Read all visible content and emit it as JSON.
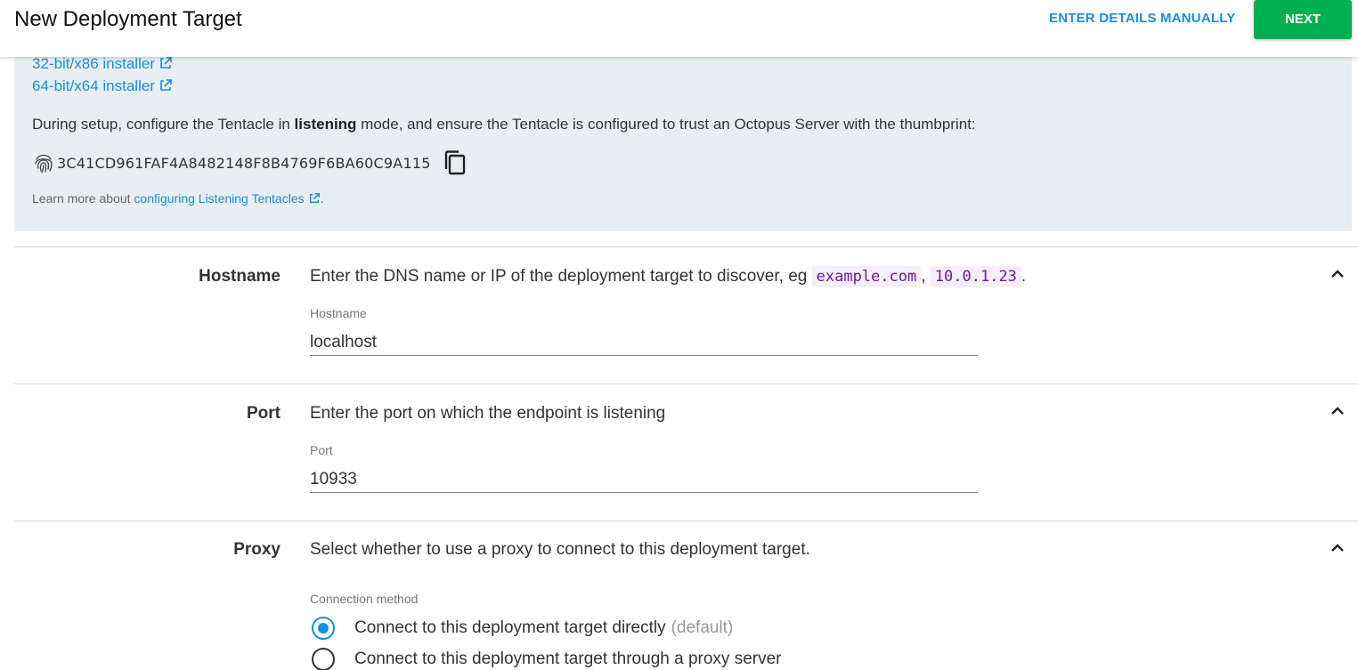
{
  "header": {
    "title": "New Deployment Target",
    "manual_label": "ENTER DETAILS MANUALLY",
    "next_label": "NEXT"
  },
  "info": {
    "installer_32_label": "32-bit/x86 installer",
    "installer_64_label": "64-bit/x64 installer",
    "setup_before": "During setup, configure the Tentacle in ",
    "setup_bold": "listening",
    "setup_after": " mode, and ensure the Tentacle is configured to trust an Octopus Server with the thumbprint:",
    "thumbprint": "3C41CD961FAF4A8482148F8B4769F6BA60C9A115",
    "learn_more_prefix": "Learn more about ",
    "learn_more_link": "configuring Listening Tentacles",
    "learn_more_suffix": "."
  },
  "hostname": {
    "section_label": "Hostname",
    "description": "Enter the DNS name or IP of the deployment target to discover, eg ",
    "example_1": "example.com",
    "separator": ", ",
    "example_2": "10.0.1.23",
    "end": ".",
    "field_label": "Hostname",
    "value": "localhost"
  },
  "port": {
    "section_label": "Port",
    "description": "Enter the port on which the endpoint is listening",
    "field_label": "Port",
    "value": "10933"
  },
  "proxy": {
    "section_label": "Proxy",
    "description": "Select whether to use a proxy to connect to this deployment target.",
    "field_label": "Connection method",
    "options": [
      {
        "label": "Connect to this deployment target directly",
        "suffix": "(default)",
        "selected": true
      },
      {
        "label": "Connect to this deployment target through a proxy server",
        "suffix": "",
        "selected": false
      }
    ]
  },
  "colors": {
    "accent": "#1a8fd8",
    "next_button": "#00b050",
    "info_panel_bg": "#e8eef1"
  },
  "icons": [
    "external-link-icon",
    "fingerprint-icon",
    "copy-icon",
    "chevron-up-icon",
    "radio-icon"
  ]
}
